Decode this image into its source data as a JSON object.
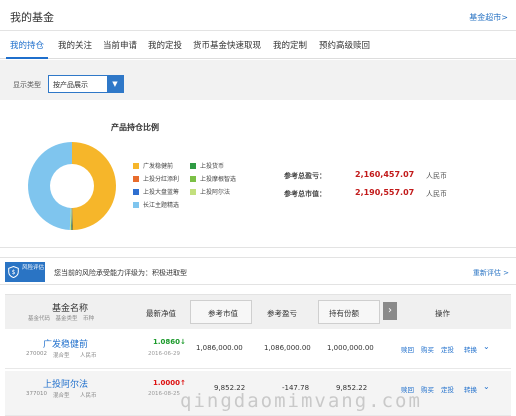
{
  "header": {
    "title": "我的基金",
    "supermarket_link": "基金超市>"
  },
  "tabs": [
    {
      "label": "我的持仓",
      "active": true
    },
    {
      "label": "我的关注"
    },
    {
      "label": "当前申请"
    },
    {
      "label": "我的定投"
    },
    {
      "label": "货币基金快速取现"
    },
    {
      "label": "我的定制"
    },
    {
      "label": "预约高级赎回"
    }
  ],
  "filter": {
    "label": "显示类型",
    "value": "按产品展示"
  },
  "chart": {
    "title": "产品持仓比例",
    "total_profit_label": "参考总盈亏：",
    "total_profit_value": "2,160,457.07",
    "total_value_label": "参考总市值：",
    "total_value_value": "2,190,557.07",
    "unit": "人民币"
  },
  "chart_data": {
    "type": "pie",
    "title": "产品持仓比例",
    "categories": [
      "广发稳健前",
      "上投货币",
      "上投分红添利",
      "上投摩根智选",
      "上投大盘蓝筹",
      "上投阿尔法",
      "长江主题精选"
    ],
    "values": [
      49.6,
      0.2,
      0.2,
      0.2,
      0.2,
      0.4,
      49.2
    ],
    "colors": [
      "#f6b62a",
      "#2f9b43",
      "#e86c2c",
      "#7cc046",
      "#2f6fd0",
      "#c3e07e",
      "#7fc5ee"
    ]
  },
  "risk": {
    "badge": "风险评估",
    "text": "您当前的风险承受能力评级为：积极进取型",
    "link": "重新评估 >"
  },
  "table": {
    "headers": {
      "fund_name": "基金名称",
      "fund_sub": "基金代码　基金类型　币种",
      "nav": "最新净值",
      "market": "参考市值",
      "profit": "参考盈亏",
      "shares": "持有份额",
      "ops": "操作"
    },
    "rows": [
      {
        "name": "广发稳健前",
        "code": "270002",
        "type": "混合型",
        "currency": "人民币",
        "nav": "1.0860↓",
        "nav_date": "2016-06-29",
        "market": "1,086,000.00",
        "profit": "1,086,000.00",
        "shares": "1,000,000.00",
        "ops": [
          "赎回",
          "购买",
          "定投",
          "转换"
        ]
      },
      {
        "name": "上投阿尔法",
        "code": "377010",
        "type": "混合型",
        "currency": "人民币",
        "nav": "1.0000↑",
        "nav_date": "2016-08-25",
        "market": "9,852.22",
        "profit": "-147.78",
        "shares": "9,852.22",
        "ops": [
          "赎回",
          "购买",
          "定投",
          "转换"
        ]
      }
    ]
  },
  "watermark": "qingdaomimvang.com"
}
